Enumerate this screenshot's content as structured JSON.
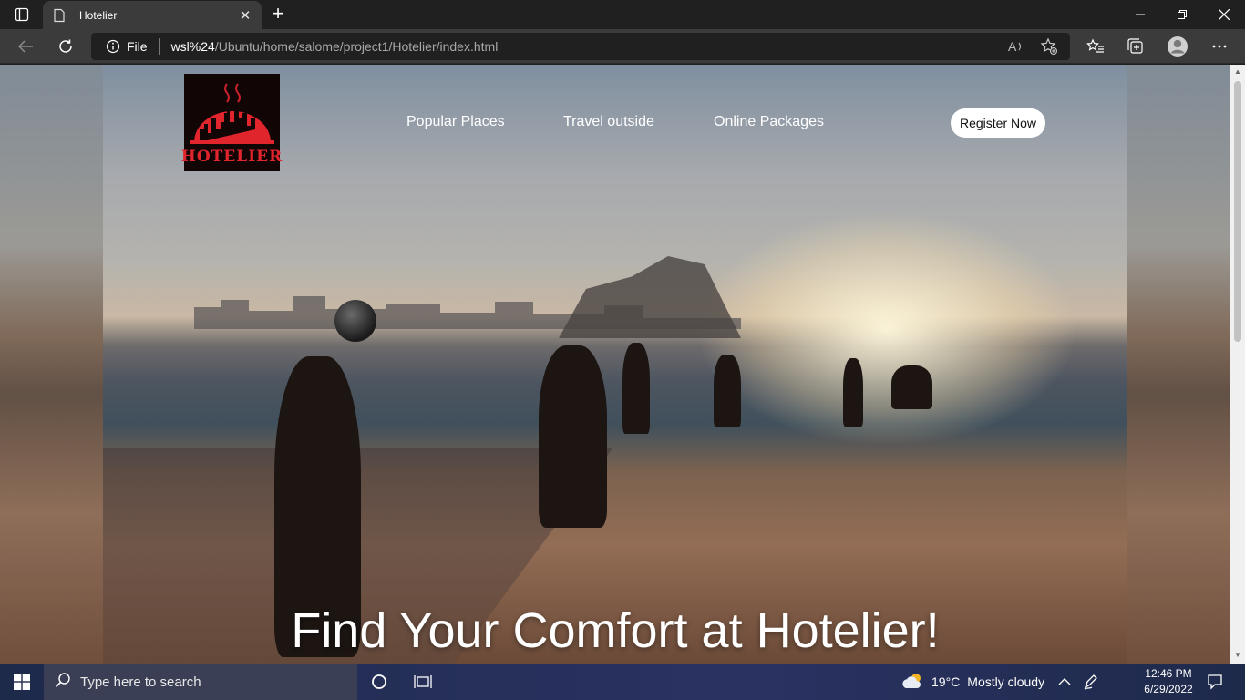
{
  "browser": {
    "tab_title": "Hotelier",
    "address": {
      "protocol_label": "File",
      "host": "wsl%24",
      "path": "/Ubuntu/home/salome/project1/Hotelier/index.html"
    }
  },
  "site": {
    "logo_text": "HOTELIER",
    "nav": [
      "Popular Places",
      "Travel outside",
      "Online Packages"
    ],
    "register_label": "Register Now",
    "headline": "Find Your Comfort at Hotelier!"
  },
  "taskbar": {
    "search_placeholder": "Type here to search",
    "weather_temp": "19°C",
    "weather_desc": "Mostly cloudy",
    "time": "12:46 PM",
    "date": "6/29/2022"
  }
}
